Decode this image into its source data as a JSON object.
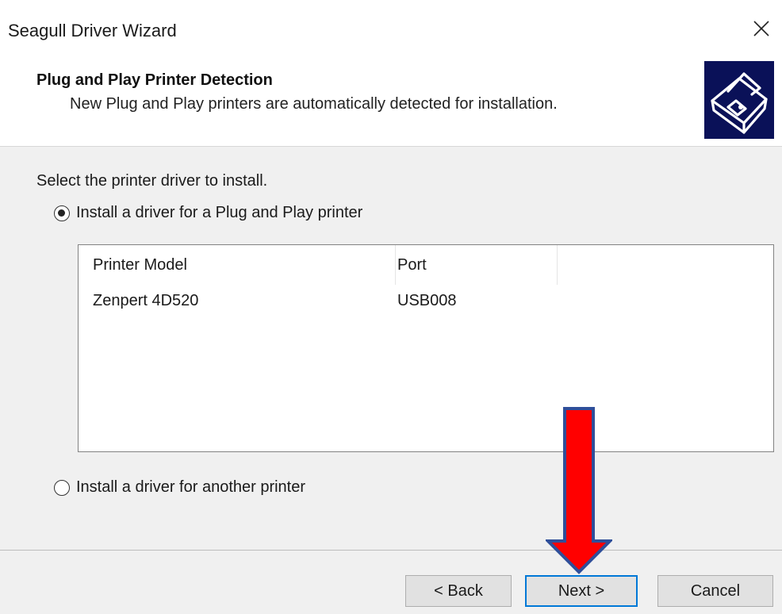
{
  "window": {
    "title": "Seagull Driver Wizard"
  },
  "header": {
    "heading": "Plug and Play Printer Detection",
    "subheading": "New Plug and Play printers are automatically detected for installation."
  },
  "body": {
    "prompt": "Select the printer driver to install.",
    "options": [
      {
        "label": "Install a driver for a Plug and Play printer",
        "selected": true
      },
      {
        "label": "Install a driver for another printer",
        "selected": false
      }
    ],
    "printer_list": {
      "columns": [
        "Printer Model",
        "Port"
      ],
      "rows": [
        {
          "model": "Zenpert 4D520",
          "port": "USB008"
        }
      ]
    }
  },
  "footer": {
    "back_label": "< Back",
    "next_label": "Next >",
    "cancel_label": "Cancel"
  },
  "icons": {
    "close": "close-icon",
    "printer": "printer-icon",
    "annotation": "red-arrow-annotation"
  },
  "colors": {
    "logo_bg": "#0a1158",
    "focus_border": "#0078d7",
    "arrow_fill": "#ff0000",
    "arrow_outline": "#2f4f9a"
  }
}
